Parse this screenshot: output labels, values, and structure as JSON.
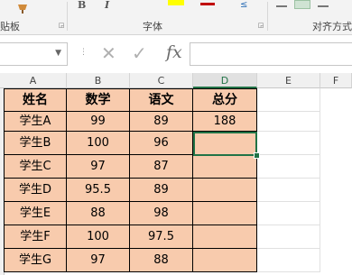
{
  "ribbon": {
    "groups": [
      {
        "label": "贴板"
      },
      {
        "label": "字体"
      },
      {
        "label": "对齐方式"
      }
    ],
    "font_buttons": [
      "B",
      "I"
    ]
  },
  "formula_bar": {
    "name_box_value": "",
    "formula_value": "",
    "cancel_icon": "cancel-icon",
    "enter_icon": "check-icon",
    "function_label": "fx"
  },
  "sheet": {
    "columns": [
      "A",
      "B",
      "C",
      "D",
      "E",
      "F"
    ],
    "selected_column": "D",
    "table": {
      "headers": [
        "姓名",
        "数学",
        "语文",
        "总分"
      ],
      "rows": [
        [
          "学生A",
          "99",
          "89",
          "188"
        ],
        [
          "学生B",
          "100",
          "96",
          ""
        ],
        [
          "学生C",
          "97",
          "87",
          ""
        ],
        [
          "学生D",
          "95.5",
          "89",
          ""
        ],
        [
          "学生E",
          "88",
          "98",
          ""
        ],
        [
          "学生F",
          "100",
          "97.5",
          ""
        ],
        [
          "学生G",
          "97",
          "88",
          ""
        ]
      ]
    },
    "fill_color": "#f8cbad",
    "selection_color": "#217346"
  }
}
